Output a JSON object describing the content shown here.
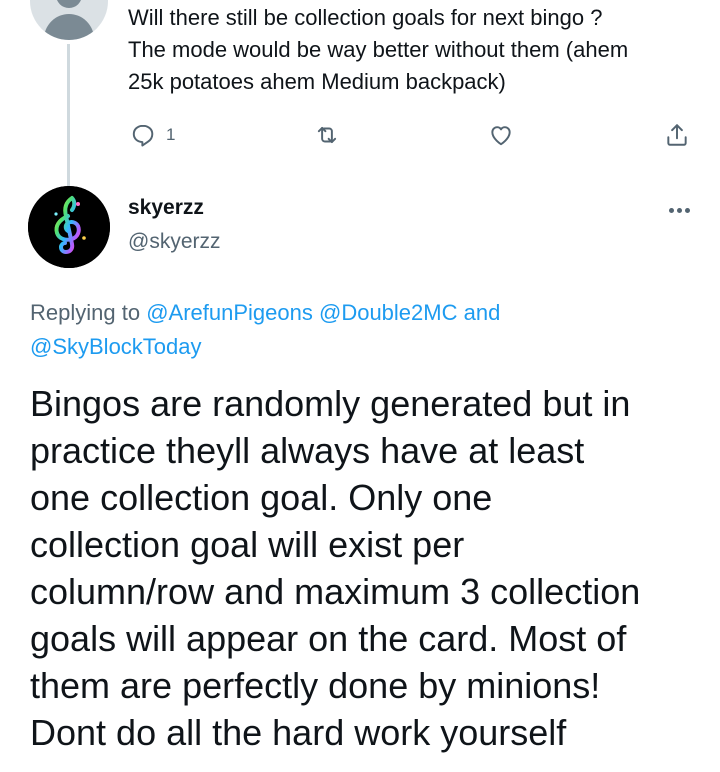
{
  "previous_tweet": {
    "text_lines": [
      "Will there still be collection goals for next bingo ?",
      "The mode would be way better without them (ahem",
      "25k potatoes ahem Medium backpack)"
    ],
    "actions": {
      "reply_icon": "reply-icon",
      "reply_count": "1",
      "retweet_icon": "retweet-icon",
      "like_icon": "heart-icon",
      "share_icon": "share-icon"
    }
  },
  "tweet": {
    "display_name": "skyerzz",
    "handle": "@skyerzz",
    "more_icon": "more-icon",
    "replying_prefix": "Replying to",
    "mentions": [
      "@ArefunPigeons",
      "@Double2MC",
      "@SkyBlockToday"
    ],
    "replying_joiner": "and",
    "body_lines": [
      "Bingos are randomly generated but in",
      "practice theyll always have at least",
      "one collection goal. Only one",
      "collection goal will exist per",
      "column/row and maximum 3 collection",
      "goals will appear on the card. Most of",
      "them are perfectly done by minions!",
      "Dont do all the hard work yourself"
    ]
  },
  "colors": {
    "link": "#1d9bf0",
    "secondary_text": "#536471",
    "primary_text": "#0f1419",
    "thread_line": "#cfd9de"
  }
}
